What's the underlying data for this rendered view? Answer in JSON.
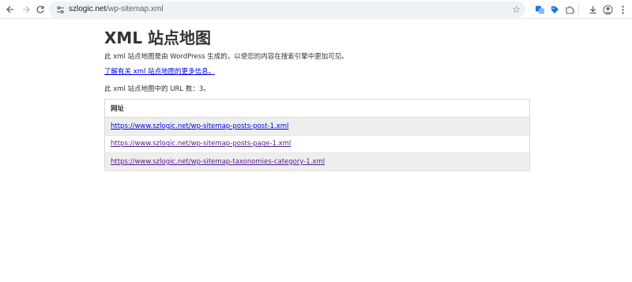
{
  "browser": {
    "url_domain": "szlogic.net",
    "url_path": "/wp-sitemap.xml",
    "icons": {
      "back": "arrow-left-icon",
      "forward": "arrow-right-icon",
      "reload": "reload-icon",
      "site_info": "tune-icon",
      "bookmark": "star-icon",
      "translate": "translate-icon",
      "extension": "tag-icon",
      "extensions": "puzzle-icon",
      "downloads": "download-icon",
      "profile": "avatar-icon",
      "menu": "more-vert-icon"
    }
  },
  "page": {
    "title": "XML 站点地图",
    "description": "此 xml 站点地图是由 WordPress 生成的，以使您的内容在搜索引擎中更加可见。",
    "more_info_link": "了解有关 xml 站点地图的更多信息。",
    "url_count_text": "此 xml 站点地图中的 URL 数：3。",
    "table": {
      "header": "网址",
      "rows": [
        "https://www.szlogic.net/wp-sitemap-posts-post-1.xml",
        "https://www.szlogic.net/wp-sitemap-posts-page-1.xml",
        "https://www.szlogic.net/wp-sitemap-taxonomies-category-1.xml"
      ]
    }
  },
  "colors": {
    "link": "#0000ee",
    "visited_link": "#551a8b",
    "stripe": "#eeeeee",
    "omnibox_bg": "#eef1f5"
  }
}
